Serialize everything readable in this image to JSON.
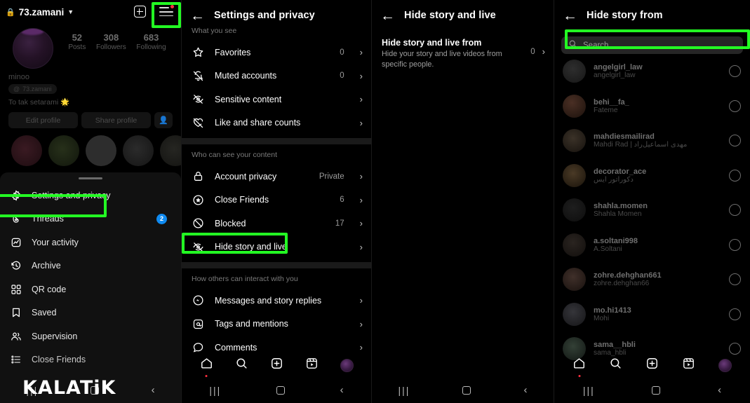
{
  "panel_profile": {
    "topbar": {
      "username": "73.zamani",
      "lock_icon": "lock-icon",
      "chevron_icon": "chevron-down-icon",
      "add_icon": "plus-square-icon",
      "menu_icon": "hamburger-menu-icon"
    },
    "stats": [
      {
        "num": "52",
        "label": "Posts"
      },
      {
        "num": "308",
        "label": "Followers"
      },
      {
        "num": "683",
        "label": "Following"
      }
    ],
    "display_name": "minoo",
    "threads_chip": "73.zamani",
    "bio": "To tak setarami 🌟",
    "actions": [
      {
        "label": "Edit profile"
      },
      {
        "label": "Share profile"
      },
      {
        "label": ""
      }
    ],
    "menu_items": [
      {
        "label": "Settings and privacy",
        "icon": "gear-icon",
        "badge": ""
      },
      {
        "label": "Threads",
        "icon": "threads-icon",
        "badge": "2"
      },
      {
        "label": "Your activity",
        "icon": "activity-icon",
        "badge": ""
      },
      {
        "label": "Archive",
        "icon": "archive-clock-icon",
        "badge": ""
      },
      {
        "label": "QR code",
        "icon": "qr-code-icon",
        "badge": ""
      },
      {
        "label": "Saved",
        "icon": "bookmark-icon",
        "badge": ""
      },
      {
        "label": "Supervision",
        "icon": "people-icon",
        "badge": ""
      },
      {
        "label": "Close Friends",
        "icon": "list-star-icon",
        "badge": ""
      }
    ]
  },
  "panel_settings": {
    "header": {
      "title": "Settings and privacy",
      "back_icon": "back-arrow-icon"
    },
    "section_1_label": "What you see",
    "section_1": [
      {
        "label": "Favorites",
        "value": "0",
        "icon": "star-icon"
      },
      {
        "label": "Muted accounts",
        "value": "0",
        "icon": "bell-off-icon"
      },
      {
        "label": "Sensitive content",
        "value": "",
        "icon": "eye-off-icon"
      },
      {
        "label": "Like and share counts",
        "value": "",
        "icon": "heart-off-icon"
      }
    ],
    "section_2_label": "Who can see your content",
    "section_2": [
      {
        "label": "Account privacy",
        "value": "Private",
        "icon": "lock-icon"
      },
      {
        "label": "Close Friends",
        "value": "6",
        "icon": "star-circle-icon"
      },
      {
        "label": "Blocked",
        "value": "17",
        "icon": "block-icon"
      },
      {
        "label": "Hide story and live",
        "value": "",
        "icon": "eye-off-icon"
      }
    ],
    "section_3_label": "How others can interact with you",
    "section_3": [
      {
        "label": "Messages and story replies",
        "value": "",
        "icon": "messenger-icon"
      },
      {
        "label": "Tags and mentions",
        "value": "",
        "icon": "at-icon"
      },
      {
        "label": "Comments",
        "value": "",
        "icon": "comment-icon"
      }
    ],
    "chevron_icon": "chevron-right-icon"
  },
  "panel_hide": {
    "header": {
      "title": "Hide story and live",
      "back_icon": "back-arrow-icon"
    },
    "item": {
      "title": "Hide story and live from",
      "subtitle": "Hide your story and live videos from specific people.",
      "value": "0",
      "chevron_icon": "chevron-right-icon"
    }
  },
  "panel_hidefrom": {
    "header": {
      "title": "Hide story from",
      "back_icon": "back-arrow-icon"
    },
    "search": {
      "placeholder": "Search",
      "value": "",
      "icon": "search-icon"
    },
    "users": [
      {
        "username": "angelgirl_law",
        "fullname": "angelgirl_law"
      },
      {
        "username": "behi__fa_",
        "fullname": "Fateme"
      },
      {
        "username": "mahdiesmailirad",
        "fullname": "Mahdi Rad | مهدی اسماعیل‌راد"
      },
      {
        "username": "decorator_ace",
        "fullname": "دکوراتور ایس"
      },
      {
        "username": "shahla.momen",
        "fullname": "Shahla Momen"
      },
      {
        "username": "a.soltani998",
        "fullname": "A.Soltani"
      },
      {
        "username": "zohre.dehghan661",
        "fullname": "zohre.dehghan66"
      },
      {
        "username": "mo.hi1413",
        "fullname": "Mohi"
      },
      {
        "username": "sama__hbli",
        "fullname": "sama_hbli"
      }
    ],
    "radio_icon": "radio-unselected-icon"
  },
  "bottom_nav": {
    "items": [
      {
        "icon": "home-icon"
      },
      {
        "icon": "search-icon"
      },
      {
        "icon": "create-plus-icon"
      },
      {
        "icon": "reels-icon"
      },
      {
        "icon": "profile-avatar-icon"
      }
    ]
  },
  "system_nav": {
    "recent_icon": "recents-icon",
    "home_icon": "home-square-icon",
    "back_icon": "back-chevron-icon"
  },
  "watermark": {
    "text": "KALATiK"
  },
  "highlight_color": "#23fb23"
}
